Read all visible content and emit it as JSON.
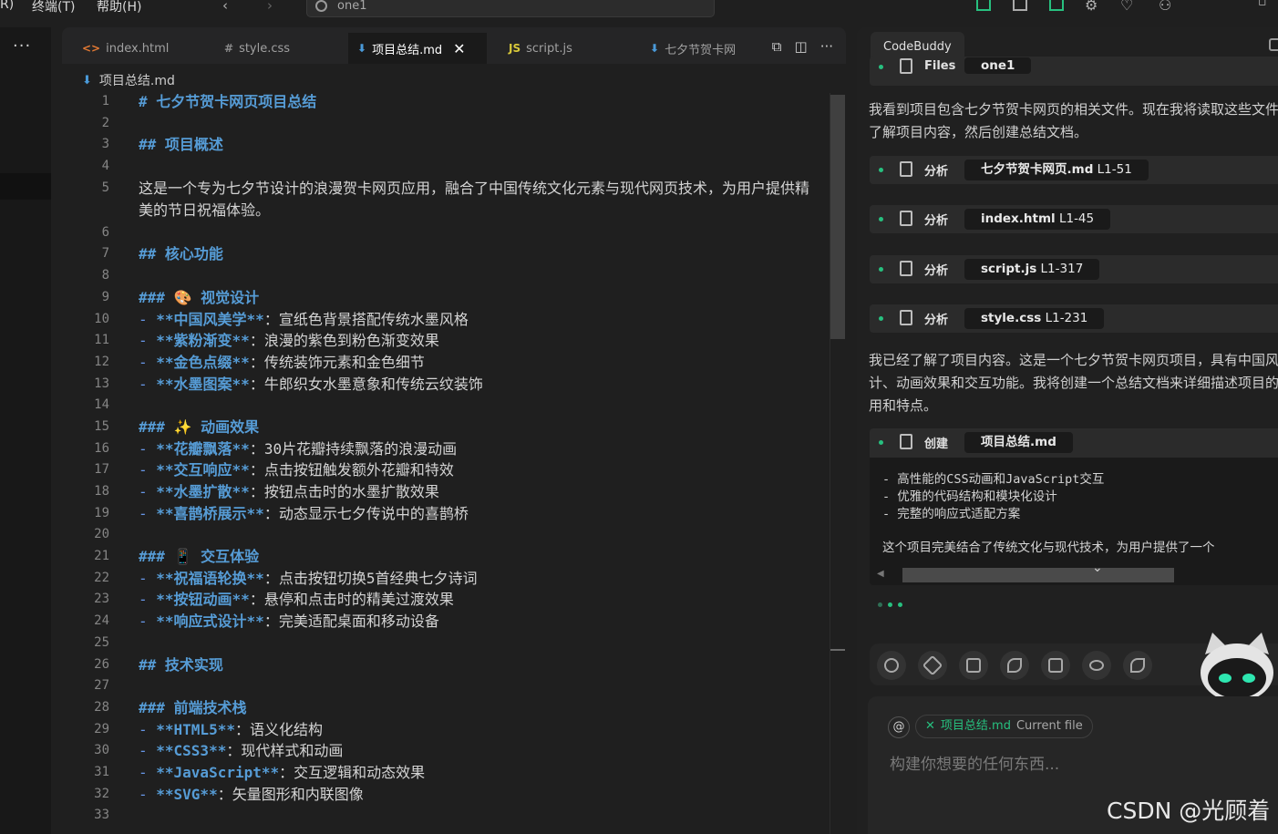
{
  "menubar": {
    "items": [
      "R)",
      "终端(T)",
      "帮助(H)"
    ],
    "search_text": "one1"
  },
  "editor": {
    "tabs": [
      {
        "icon": "<>",
        "label": "index.html"
      },
      {
        "icon": "#",
        "label": "style.css"
      },
      {
        "icon": "⬇",
        "label": "项目总结.md",
        "active": true
      },
      {
        "icon": "JS",
        "label": "script.js"
      },
      {
        "icon": "⬇",
        "label": "七夕节贺卡网"
      }
    ],
    "breadcrumb": "项目总结.md",
    "lines": [
      {
        "n": "1",
        "segs": [
          {
            "t": "# 七夕节贺卡网页项目总结",
            "c": "h"
          }
        ]
      },
      {
        "n": "2",
        "segs": []
      },
      {
        "n": "3",
        "segs": [
          {
            "t": "## 项目概述",
            "c": "h"
          }
        ]
      },
      {
        "n": "4",
        "segs": []
      },
      {
        "n": "5",
        "wrap": true,
        "segs": [
          {
            "t": "这是一个专为七夕节设计的浪漫贺卡网页应用，融合了中国传统文化元素与现代网页技术，为用户提供精美的节日祝福体验。",
            "c": ""
          }
        ]
      },
      {
        "n": "6",
        "segs": []
      },
      {
        "n": "7",
        "segs": [
          {
            "t": "## 核心功能",
            "c": "h"
          }
        ]
      },
      {
        "n": "8",
        "segs": []
      },
      {
        "n": "9",
        "segs": [
          {
            "t": "### 🎨 视觉设计",
            "c": "h"
          }
        ]
      },
      {
        "n": "10",
        "segs": [
          {
            "t": "- ",
            "c": "dash"
          },
          {
            "t": "**中国风美学**",
            "c": "b"
          },
          {
            "t": "：宣纸色背景搭配传统水墨风格",
            "c": ""
          }
        ]
      },
      {
        "n": "11",
        "segs": [
          {
            "t": "- ",
            "c": "dash"
          },
          {
            "t": "**紫粉渐变**",
            "c": "b"
          },
          {
            "t": "：浪漫的紫色到粉色渐变效果",
            "c": ""
          }
        ]
      },
      {
        "n": "12",
        "segs": [
          {
            "t": "- ",
            "c": "dash"
          },
          {
            "t": "**金色点缀**",
            "c": "b"
          },
          {
            "t": "：传统装饰元素和金色细节",
            "c": ""
          }
        ]
      },
      {
        "n": "13",
        "segs": [
          {
            "t": "- ",
            "c": "dash"
          },
          {
            "t": "**水墨图案**",
            "c": "b"
          },
          {
            "t": "：牛郎织女水墨意象和传统云纹装饰",
            "c": ""
          }
        ]
      },
      {
        "n": "14",
        "segs": []
      },
      {
        "n": "15",
        "segs": [
          {
            "t": "### ✨ 动画效果",
            "c": "h"
          }
        ]
      },
      {
        "n": "16",
        "segs": [
          {
            "t": "- ",
            "c": "dash"
          },
          {
            "t": "**花瓣飘落**",
            "c": "b"
          },
          {
            "t": "：30片花瓣持续飘落的浪漫动画",
            "c": ""
          }
        ]
      },
      {
        "n": "17",
        "segs": [
          {
            "t": "- ",
            "c": "dash"
          },
          {
            "t": "**交互响应**",
            "c": "b"
          },
          {
            "t": "：点击按钮触发额外花瓣和特效",
            "c": ""
          }
        ]
      },
      {
        "n": "18",
        "segs": [
          {
            "t": "- ",
            "c": "dash"
          },
          {
            "t": "**水墨扩散**",
            "c": "b"
          },
          {
            "t": "：按钮点击时的水墨扩散效果",
            "c": ""
          }
        ]
      },
      {
        "n": "19",
        "segs": [
          {
            "t": "- ",
            "c": "dash"
          },
          {
            "t": "**喜鹊桥展示**",
            "c": "b"
          },
          {
            "t": "：动态显示七夕传说中的喜鹊桥",
            "c": ""
          }
        ]
      },
      {
        "n": "20",
        "segs": []
      },
      {
        "n": "21",
        "segs": [
          {
            "t": "### 📱 交互体验",
            "c": "h"
          }
        ]
      },
      {
        "n": "22",
        "segs": [
          {
            "t": "- ",
            "c": "dash"
          },
          {
            "t": "**祝福语轮换**",
            "c": "b"
          },
          {
            "t": "：点击按钮切换5首经典七夕诗词",
            "c": ""
          }
        ]
      },
      {
        "n": "23",
        "segs": [
          {
            "t": "- ",
            "c": "dash"
          },
          {
            "t": "**按钮动画**",
            "c": "b"
          },
          {
            "t": "：悬停和点击时的精美过渡效果",
            "c": ""
          }
        ]
      },
      {
        "n": "24",
        "segs": [
          {
            "t": "- ",
            "c": "dash"
          },
          {
            "t": "**响应式设计**",
            "c": "b"
          },
          {
            "t": "：完美适配桌面和移动设备",
            "c": ""
          }
        ]
      },
      {
        "n": "25",
        "segs": []
      },
      {
        "n": "26",
        "segs": [
          {
            "t": "## 技术实现",
            "c": "h"
          }
        ]
      },
      {
        "n": "27",
        "segs": []
      },
      {
        "n": "28",
        "segs": [
          {
            "t": "### 前端技术栈",
            "c": "h"
          }
        ]
      },
      {
        "n": "29",
        "segs": [
          {
            "t": "- ",
            "c": "dash"
          },
          {
            "t": "**HTML5**",
            "c": "b"
          },
          {
            "t": "：语义化结构",
            "c": ""
          }
        ]
      },
      {
        "n": "30",
        "segs": [
          {
            "t": "- ",
            "c": "dash"
          },
          {
            "t": "**CSS3**",
            "c": "b"
          },
          {
            "t": "：现代样式和动画",
            "c": ""
          }
        ]
      },
      {
        "n": "31",
        "segs": [
          {
            "t": "- ",
            "c": "dash"
          },
          {
            "t": "**JavaScript**",
            "c": "b"
          },
          {
            "t": "：交互逻辑和动态效果",
            "c": ""
          }
        ]
      },
      {
        "n": "32",
        "segs": [
          {
            "t": "- ",
            "c": "dash"
          },
          {
            "t": "**SVG**",
            "c": "b"
          },
          {
            "t": "：矢量图形和内联图像",
            "c": ""
          }
        ]
      },
      {
        "n": "33",
        "segs": []
      }
    ]
  },
  "panel": {
    "tab": "CodeBuddy",
    "partial_tool": {
      "verb": "Files",
      "chip": "one1"
    },
    "intro": "我看到项目包含七夕节贺卡网页的相关文件。现在我将读取这些文件来了解项目内容，然后创建总结文档。",
    "tools": [
      {
        "verb": "分析",
        "file": "七夕节贺卡网页.md",
        "range": "L1-51"
      },
      {
        "verb": "分析",
        "file": "index.html",
        "range": "L1-45"
      },
      {
        "verb": "分析",
        "file": "script.js",
        "range": "L1-317"
      },
      {
        "verb": "分析",
        "file": "style.css",
        "range": "L1-231"
      }
    ],
    "summary": "我已经了解了项目内容。这是一个七夕节贺卡网页项目，具有中国风设计、动画效果和交互功能。我将创建一个总结文档来详细描述项目的作用和特点。",
    "create": {
      "verb": "创建",
      "file": "项目总结.md"
    },
    "create_lines": [
      "- 高性能的CSS动画和JavaScript交互",
      "- 优雅的代码结构和模块化设计",
      "- 完整的响应式适配方案",
      "这个项目完美结合了传统文化与现代技术，为用户提供了一个"
    ],
    "context_chip": {
      "name": "项目总结.md",
      "sub": "Current file"
    },
    "input_placeholder": "构建你想要的任何东西..."
  },
  "watermark": "CSDN @光顾着",
  "colors": {
    "accent": "#27c07f",
    "heading": "#569cd6"
  }
}
